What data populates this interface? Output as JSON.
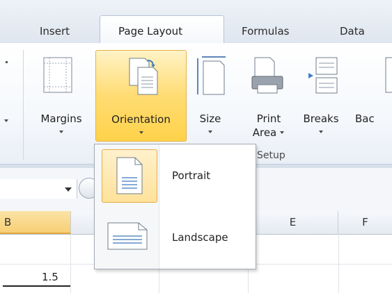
{
  "tabs": [
    {
      "label": "Insert",
      "active": false
    },
    {
      "label": "Page Layout",
      "active": true
    },
    {
      "label": "Formulas",
      "active": false
    },
    {
      "label": "Data",
      "active": false
    }
  ],
  "ribbon": {
    "buttons": [
      {
        "label": "Margins",
        "icon": "margins-icon",
        "has_arrow": true
      },
      {
        "label": "Orientation",
        "icon": "orientation-icon",
        "has_arrow": true,
        "state": "pressed"
      },
      {
        "label": "Size",
        "icon": "size-icon",
        "has_arrow": true
      },
      {
        "label_line1": "Print",
        "label_line2": "Area",
        "icon": "print-area-icon",
        "has_arrow": true
      },
      {
        "label": "Breaks",
        "icon": "breaks-icon",
        "has_arrow": true
      },
      {
        "label": "Bac",
        "icon": "background-icon",
        "has_arrow": false
      }
    ],
    "group_label": "Setup"
  },
  "orientation_menu": {
    "items": [
      {
        "label": "Portrait",
        "icon": "portrait-page-icon",
        "highlighted": true
      },
      {
        "label": "Landscape",
        "icon": "landscape-page-icon",
        "highlighted": false
      }
    ]
  },
  "sheet": {
    "columns": [
      "B",
      "E",
      "F"
    ],
    "selected_column": "B",
    "cells": [
      {
        "column": "B",
        "value": "1.5"
      }
    ]
  },
  "colors": {
    "accent_highlight": "#ffd24a",
    "highlight_border": "#e3b24b",
    "ribbon_border": "#b5c3d5"
  }
}
